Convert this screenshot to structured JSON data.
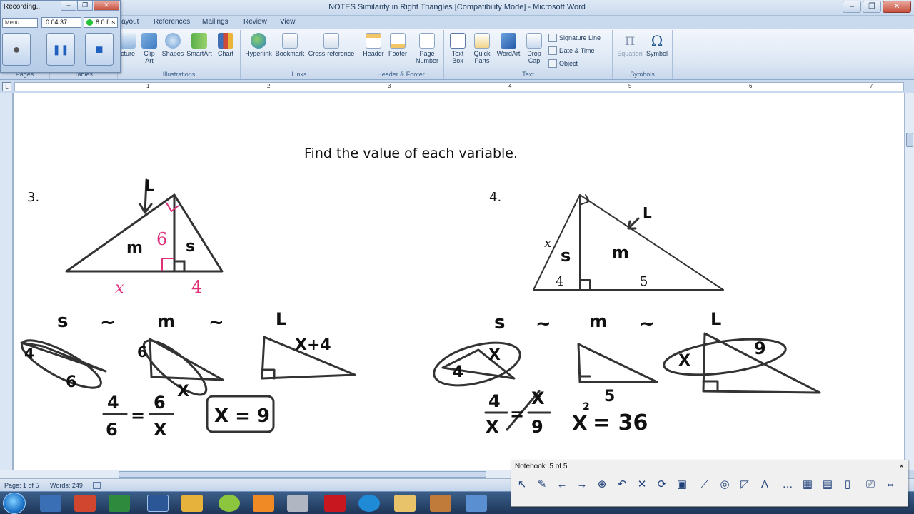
{
  "window": {
    "title": "NOTES Similarity in Right Triangles [Compatibility Mode] - Microsoft Word",
    "minimize_glyph": "–",
    "restore_glyph": "❐",
    "close_glyph": "✕"
  },
  "ribbon_tabs": [
    "ayout",
    "References",
    "Mailings",
    "Review",
    "View"
  ],
  "ribbon": {
    "groups": {
      "pages": "Pages",
      "tables": "Tables",
      "illustrations": "Illustrations",
      "links": "Links",
      "header_footer": "Header & Footer",
      "text": "Text",
      "symbols": "Symbols"
    },
    "buttons": {
      "picture": "cture",
      "clip_art": "Clip Art",
      "shapes": "Shapes",
      "smartart": "SmartArt",
      "chart": "Chart",
      "hyperlink": "Hyperlink",
      "bookmark": "Bookmark",
      "cross_reference": "Cross-reference",
      "header": "Header",
      "footer": "Footer",
      "page_number": "Page Number",
      "text_box": "Text Box",
      "quick_parts": "Quick Parts",
      "wordart": "WordArt",
      "drop_cap": "Drop Cap",
      "signature_line": "Signature Line",
      "date_time": "Date & Time",
      "object": "Object",
      "equation": "Equation",
      "symbol": "Symbol"
    }
  },
  "ruler_numbers": [
    "1",
    "2",
    "3",
    "4",
    "5",
    "6",
    "7"
  ],
  "document": {
    "heading": "Find the value of each variable.",
    "problem3": {
      "number": "3.",
      "labels": {
        "L": "L",
        "m": "m",
        "s": "s",
        "six": "6",
        "x": "x",
        "four": "4"
      },
      "similarity": {
        "s": "s",
        "m": "m",
        "L": "L",
        "tilde": "~"
      },
      "work": {
        "xplus4": "X+4",
        "tri_s_a": "4",
        "tri_s_b": "6",
        "tri_m_a": "6",
        "tri_m_b": "X",
        "frac_num_l": "4",
        "frac_den_l": "6",
        "equals": "=",
        "frac_num_r": "6",
        "frac_den_r": "X",
        "answer": "X = 9"
      }
    },
    "problem4": {
      "number": "4.",
      "labels": {
        "L": "L",
        "m": "m",
        "s": "s",
        "x": "x",
        "four": "4",
        "five": "5"
      },
      "similarity": {
        "s": "s",
        "m": "m",
        "L": "L",
        "tilde": "~"
      },
      "work": {
        "tri_s_a": "4",
        "tri_s_b": "X",
        "tri_L_a": "X",
        "tri_L_b": "9",
        "frac_num_l": "4",
        "frac_den_l": "X",
        "equals": "=",
        "frac_num_r": "X",
        "frac_den_r": "9",
        "five": "5",
        "eq_left": "X",
        "eq_sq": "2",
        "eq_right": "= 36"
      }
    }
  },
  "status": {
    "page": "Page: 1 of 5",
    "words": "Words: 249"
  },
  "recorder": {
    "title": "Recording...",
    "menu": "Menu",
    "time": "0:04:37",
    "fps": "8.0 fps",
    "record_glyph": "●",
    "pause_glyph": "❚❚",
    "stop_glyph": "■"
  },
  "notebook": {
    "title": "Notebook",
    "page_info": "5 of 5",
    "close_glyph": "✕",
    "tools": [
      "↖",
      "✎",
      "←",
      "→",
      "⊕",
      "↶",
      "✕",
      "⟳",
      "▣",
      "⟋",
      "◎",
      "◸",
      "A",
      "…",
      "▦",
      "▤",
      "▯",
      "⎚",
      "⇔"
    ]
  },
  "colors": {
    "accent": "#1e395b",
    "pink": "#e0307a",
    "ink": "#111111"
  }
}
